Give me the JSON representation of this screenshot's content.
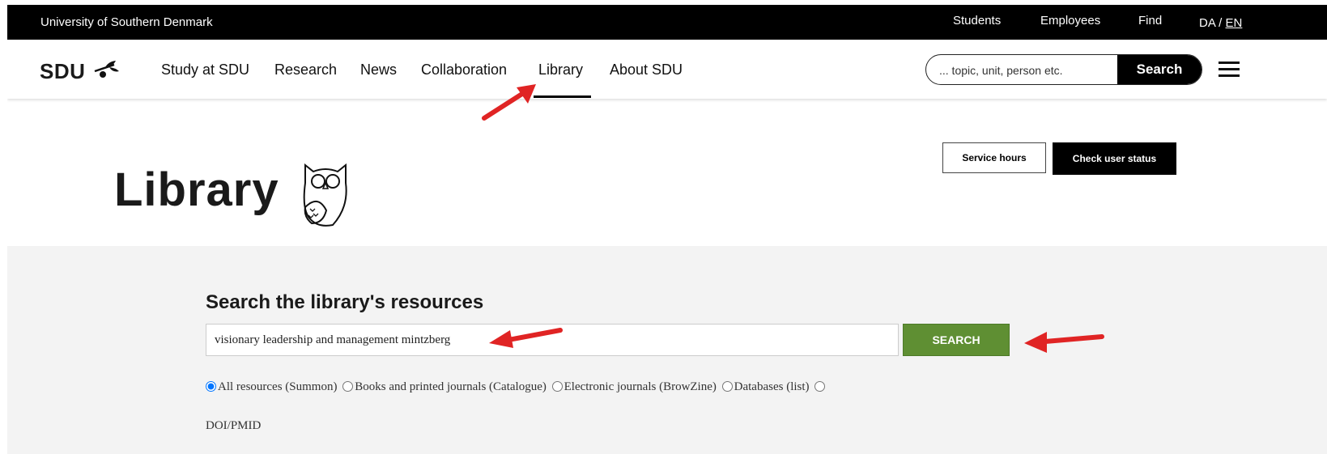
{
  "topbar": {
    "university": "University of Southern Denmark",
    "links": [
      "Students",
      "Employees",
      "Find"
    ],
    "lang_da": "DA",
    "lang_sep": " / ",
    "lang_en": "EN"
  },
  "nav": {
    "logo": "SDU",
    "items": [
      "Study at SDU",
      "Research",
      "News",
      "Collaboration",
      "Library",
      "About SDU"
    ],
    "active": "Library",
    "search_placeholder": "... topic, unit, person etc.",
    "search_button": "Search"
  },
  "hero": {
    "title": "Library",
    "service_hours": "Service hours",
    "check_user_status": "Check user status"
  },
  "library_search": {
    "title": "Search the library's resources",
    "query": "visionary leadership and management mintzberg",
    "button": "SEARCH",
    "options": [
      {
        "label": "All resources (Summon)",
        "checked": true
      },
      {
        "label": "Books and printed journals (Catalogue)",
        "checked": false
      },
      {
        "label": "Electronic journals (BrowZine)",
        "checked": false
      },
      {
        "label": "Databases (list)",
        "checked": false
      },
      {
        "label": "DOI/PMID",
        "checked": false
      }
    ]
  },
  "colors": {
    "topbar": "#000000",
    "search_green": "#5f8f33",
    "panel_bg": "#f3f3f3",
    "annotation_arrow": "#e02424"
  }
}
